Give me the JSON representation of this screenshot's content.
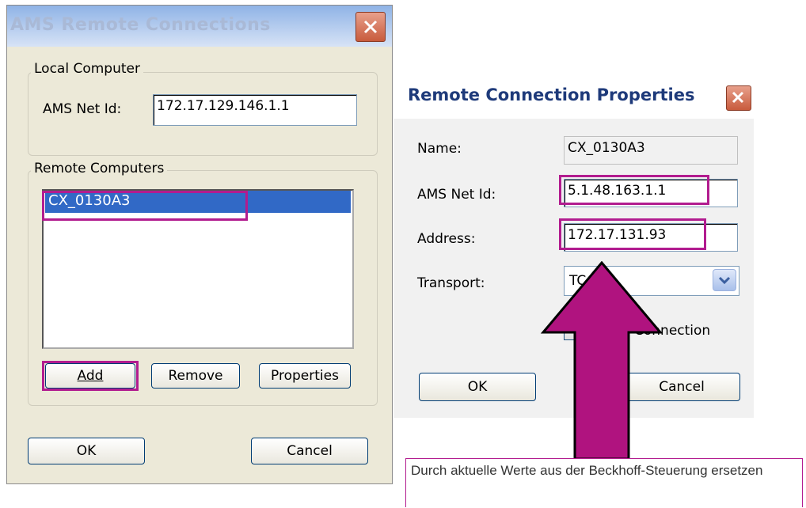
{
  "dialog1": {
    "title": "AMS Remote Connections",
    "local_group_label": "Local Computer",
    "ams_net_id_label": "AMS Net Id:",
    "ams_net_id_value": "172.17.129.146.1.1",
    "remote_group_label": "Remote Computers",
    "remote_items": [
      "CX_0130A3"
    ],
    "add_label": "Add",
    "remove_label": "Remove",
    "properties_label": "Properties",
    "ok_label": "OK",
    "cancel_label": "Cancel"
  },
  "dialog2": {
    "title": "Remote Connection Properties",
    "name_label": "Name:",
    "name_value": "CX_0130A3",
    "ams_net_id_label": "AMS Net Id:",
    "ams_net_id_value": "5.1.48.163.1.1",
    "address_label": "Address:",
    "address_value": "172.17.131.93",
    "transport_label": "Transport:",
    "transport_value": "TC",
    "connection_label": "Connection",
    "ok_label": "OK",
    "cancel_label": "Cancel"
  },
  "annotation": {
    "text": "Durch aktuelle Werte aus der Beckhoff-Steuerung ersetzen",
    "highlight_color": "#b21c8f"
  }
}
